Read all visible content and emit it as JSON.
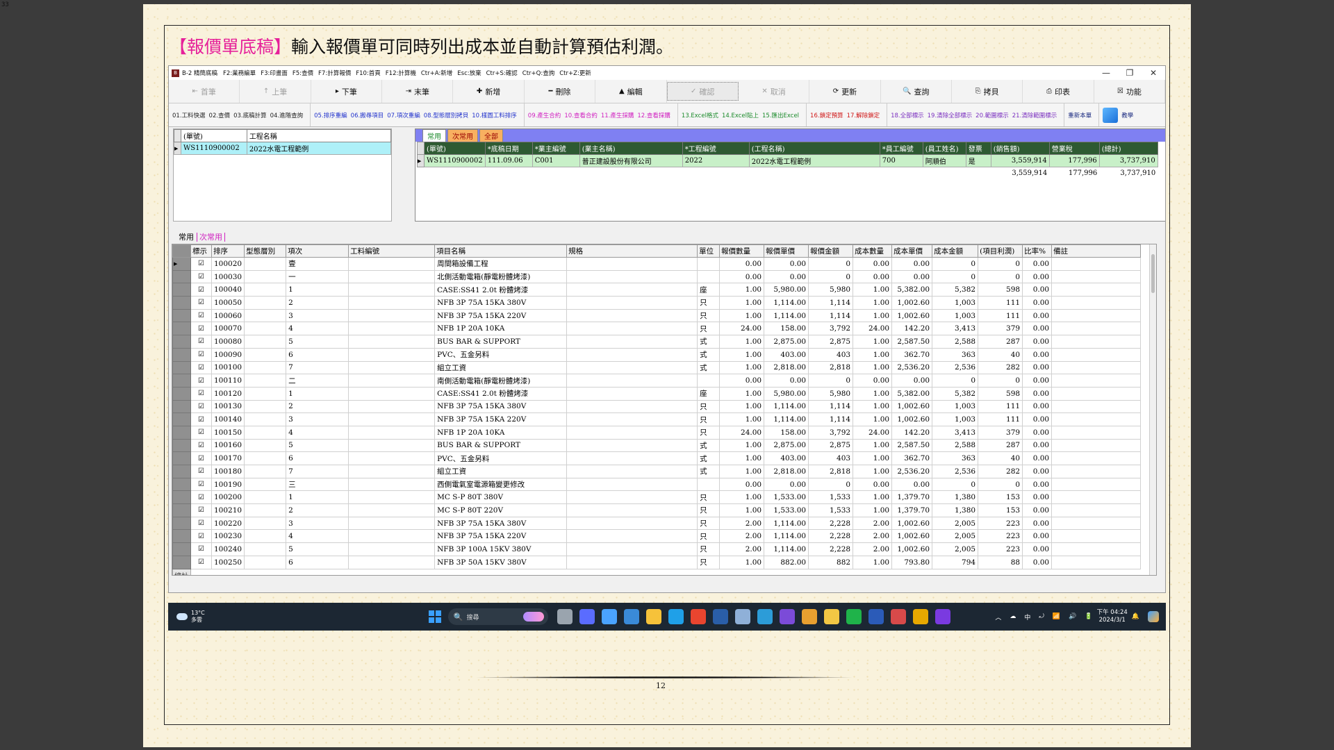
{
  "corner_text": "33",
  "heading": {
    "tag": "【報價單底稿】",
    "text": "輸入報價單可同時列出成本並自動計算預估利潤。"
  },
  "titlebar": {
    "app_icon": "B",
    "title": "B-2 精簡底稿",
    "shortcuts": [
      "F2:業務編單",
      "F3:印畫面",
      "F5:查價",
      "F7:計算報價",
      "F10:首頁",
      "F12:計算機",
      "Ctr+A:新增",
      "Esc:放棄",
      "Ctr+S:確認",
      "Ctr+Q:查詢",
      "Ctr+Z:更新"
    ],
    "controls": [
      "—",
      "❐",
      "✕"
    ]
  },
  "toolbar1": [
    {
      "label": "首筆",
      "icon": "⇤",
      "disabled": true
    },
    {
      "label": "上筆",
      "icon": "↑",
      "disabled": true
    },
    {
      "label": "下筆",
      "icon": "▸",
      "disabled": false
    },
    {
      "label": "末筆",
      "icon": "⇥",
      "disabled": false
    },
    {
      "label": "新增",
      "icon": "✚",
      "disabled": false
    },
    {
      "label": "刪除",
      "icon": "━",
      "disabled": false
    },
    {
      "label": "編輯",
      "icon": "▲",
      "disabled": false
    },
    {
      "label": "確認",
      "icon": "✓",
      "disabled": true,
      "focus": true
    },
    {
      "label": "取消",
      "icon": "✕",
      "disabled": true
    },
    {
      "label": "更新",
      "icon": "⟳",
      "disabled": false
    },
    {
      "label": "查詢",
      "icon": "🔍",
      "disabled": false
    },
    {
      "label": "拷貝",
      "icon": "⎘",
      "disabled": false
    },
    {
      "label": "印表",
      "icon": "⎙",
      "disabled": false
    },
    {
      "label": "功能",
      "icon": "☒",
      "disabled": false
    }
  ],
  "toolbar2": {
    "groups": [
      {
        "color": "c-black",
        "items": [
          "01.工料快選",
          "02.查價",
          "03.底稿計算",
          "04.進階查詢"
        ]
      },
      {
        "color": "c-blue",
        "items": [
          "05.排序重編",
          "06.搬尋項目",
          "07.項次重編",
          "08.型態層別拷貝",
          "10.樣圖工料排序"
        ]
      },
      {
        "color": "c-mag",
        "items": [
          "09.產生合約",
          "10.查看合約",
          "11.產生採購",
          "12.查看採購"
        ]
      },
      {
        "color": "c-green",
        "items": [
          "13.Excel格式",
          "14.Excel貼上",
          "15.匯出Excel"
        ]
      },
      {
        "color": "c-red",
        "items": [
          "16.鎖定預算",
          "17.解除鎖定"
        ]
      },
      {
        "color": "c-purple",
        "items": [
          "18.全部標示",
          "19.清除全部標示",
          "20.範圍標示",
          "21.清除範圍標示"
        ]
      },
      {
        "color": "c-navy",
        "items": [
          "重新本單"
        ]
      }
    ],
    "teach_label": "教學"
  },
  "mini_table": {
    "headers": [
      "(單號)",
      "工程名稱"
    ],
    "row": [
      "WS1110900002",
      "2022水電工程範例"
    ]
  },
  "right_panel": {
    "tabs": [
      "常用",
      "次常用",
      "全部"
    ],
    "headers": [
      "(單號)",
      "*底稿日期",
      "*業主編號",
      "(業主名稱)",
      "*工程編號",
      "(工程名稱)",
      "*員工編號",
      "(員工姓名)",
      "發票",
      "(銷售額)",
      "營業稅",
      "(總計)"
    ],
    "row": [
      "WS1110900002",
      "111.09.06",
      "C001",
      "普正建設股份有限公司",
      "2022",
      "2022水電工程範例",
      "700",
      "阿順伯",
      "是",
      "3,559,914",
      "177,996",
      "3,737,910"
    ],
    "totals": [
      "3,559,914",
      "177,996",
      "3,737,910"
    ]
  },
  "sub_tabs": [
    "常用",
    "次常用"
  ],
  "grid": {
    "headers": [
      "標示",
      "排序",
      "型態層別",
      "項次",
      "工料編號",
      "項目名稱",
      "規格",
      "單位",
      "報價數量",
      "報價單價",
      "報價金額",
      "成本數量",
      "成本單價",
      "成本金額",
      "(項目利潤)",
      "比率%",
      "備註"
    ],
    "checkbox_glyph": "☑",
    "rows": [
      [
        "100020",
        "",
        "壹",
        "",
        "周間箱設備工程",
        "",
        "",
        "0.00",
        "0.00",
        "0",
        "0.00",
        "0.00",
        "0",
        "0",
        "0.00",
        ""
      ],
      [
        "100030",
        "",
        "一",
        "",
        "北側活動電箱(靜電粉體烤漆)",
        "",
        "",
        "0.00",
        "0.00",
        "0",
        "0.00",
        "0.00",
        "0",
        "0",
        "0.00",
        ""
      ],
      [
        "100040",
        "",
        "1",
        "",
        "CASE:SS41 2.0t  粉體烤漆",
        "",
        "座",
        "1.00",
        "5,980.00",
        "5,980",
        "1.00",
        "5,382.00",
        "5,382",
        "598",
        "0.00",
        ""
      ],
      [
        "100050",
        "",
        "2",
        "",
        "NFB 3P 75A  15KA 380V",
        "",
        "只",
        "1.00",
        "1,114.00",
        "1,114",
        "1.00",
        "1,002.60",
        "1,003",
        "111",
        "0.00",
        ""
      ],
      [
        "100060",
        "",
        "3",
        "",
        "NFB 3P 75A  15KA 220V",
        "",
        "只",
        "1.00",
        "1,114.00",
        "1,114",
        "1.00",
        "1,002.60",
        "1,003",
        "111",
        "0.00",
        ""
      ],
      [
        "100070",
        "",
        "4",
        "",
        "NFB 1P 20A 10KA",
        "",
        "只",
        "24.00",
        "158.00",
        "3,792",
        "24.00",
        "142.20",
        "3,413",
        "379",
        "0.00",
        ""
      ],
      [
        "100080",
        "",
        "5",
        "",
        "BUS BAR & SUPPORT",
        "",
        "式",
        "1.00",
        "2,875.00",
        "2,875",
        "1.00",
        "2,587.50",
        "2,588",
        "287",
        "0.00",
        ""
      ],
      [
        "100090",
        "",
        "6",
        "",
        "PVC、五金另料",
        "",
        "式",
        "1.00",
        "403.00",
        "403",
        "1.00",
        "362.70",
        "363",
        "40",
        "0.00",
        ""
      ],
      [
        "100100",
        "",
        "7",
        "",
        "組立工資",
        "",
        "式",
        "1.00",
        "2,818.00",
        "2,818",
        "1.00",
        "2,536.20",
        "2,536",
        "282",
        "0.00",
        ""
      ],
      [
        "100110",
        "",
        "二",
        "",
        "南側活動電箱(靜電粉體烤漆)",
        "",
        "",
        "0.00",
        "0.00",
        "0",
        "0.00",
        "0.00",
        "0",
        "0",
        "0.00",
        ""
      ],
      [
        "100120",
        "",
        "1",
        "",
        "CASE:SS41 2.0t  粉體烤漆",
        "",
        "座",
        "1.00",
        "5,980.00",
        "5,980",
        "1.00",
        "5,382.00",
        "5,382",
        "598",
        "0.00",
        ""
      ],
      [
        "100130",
        "",
        "2",
        "",
        "NFB 3P 75A  15KA 380V",
        "",
        "只",
        "1.00",
        "1,114.00",
        "1,114",
        "1.00",
        "1,002.60",
        "1,003",
        "111",
        "0.00",
        ""
      ],
      [
        "100140",
        "",
        "3",
        "",
        "NFB 3P 75A  15KA 220V",
        "",
        "只",
        "1.00",
        "1,114.00",
        "1,114",
        "1.00",
        "1,002.60",
        "1,003",
        "111",
        "0.00",
        ""
      ],
      [
        "100150",
        "",
        "4",
        "",
        "NFB 1P 20A 10KA",
        "",
        "只",
        "24.00",
        "158.00",
        "3,792",
        "24.00",
        "142.20",
        "3,413",
        "379",
        "0.00",
        ""
      ],
      [
        "100160",
        "",
        "5",
        "",
        "BUS BAR & SUPPORT",
        "",
        "式",
        "1.00",
        "2,875.00",
        "2,875",
        "1.00",
        "2,587.50",
        "2,588",
        "287",
        "0.00",
        ""
      ],
      [
        "100170",
        "",
        "6",
        "",
        "PVC、五金另料",
        "",
        "式",
        "1.00",
        "403.00",
        "403",
        "1.00",
        "362.70",
        "363",
        "40",
        "0.00",
        ""
      ],
      [
        "100180",
        "",
        "7",
        "",
        "組立工資",
        "",
        "式",
        "1.00",
        "2,818.00",
        "2,818",
        "1.00",
        "2,536.20",
        "2,536",
        "282",
        "0.00",
        ""
      ],
      [
        "100190",
        "",
        "三",
        "",
        "西側電氣室電源箱變更修改",
        "",
        "",
        "0.00",
        "0.00",
        "0",
        "0.00",
        "0.00",
        "0",
        "0",
        "0.00",
        ""
      ],
      [
        "100200",
        "",
        "1",
        "",
        "MC S-P 80T 380V",
        "",
        "只",
        "1.00",
        "1,533.00",
        "1,533",
        "1.00",
        "1,379.70",
        "1,380",
        "153",
        "0.00",
        ""
      ],
      [
        "100210",
        "",
        "2",
        "",
        "MC S-P 80T 220V",
        "",
        "只",
        "1.00",
        "1,533.00",
        "1,533",
        "1.00",
        "1,379.70",
        "1,380",
        "153",
        "0.00",
        ""
      ],
      [
        "100220",
        "",
        "3",
        "",
        "NFB 3P 75A  15KA 380V",
        "",
        "只",
        "2.00",
        "1,114.00",
        "2,228",
        "2.00",
        "1,002.60",
        "2,005",
        "223",
        "0.00",
        ""
      ],
      [
        "100230",
        "",
        "4",
        "",
        "NFB 3P 75A  15KA 220V",
        "",
        "只",
        "2.00",
        "1,114.00",
        "2,228",
        "2.00",
        "1,002.60",
        "2,005",
        "223",
        "0.00",
        ""
      ],
      [
        "100240",
        "",
        "5",
        "",
        "NFB 3P 100A 15KV 380V",
        "",
        "只",
        "2.00",
        "1,114.00",
        "2,228",
        "2.00",
        "1,002.60",
        "2,005",
        "223",
        "0.00",
        ""
      ],
      [
        "100250",
        "",
        "6",
        "",
        "NFB 3P 50A 15KV 380V",
        "",
        "只",
        "1.00",
        "882.00",
        "882",
        "1.00",
        "793.80",
        "794",
        "88",
        "0.00",
        ""
      ]
    ],
    "total_label": "總計"
  },
  "taskbar": {
    "temperature": "13°C",
    "weather": "多雲",
    "search_placeholder": "搜尋",
    "icon_colors": [
      "#9aa4ae",
      "#5a6cff",
      "#4aa3ff",
      "#3a8ad8",
      "#f6c23a",
      "#1fa0e8",
      "#e9452f",
      "#2a5ea8",
      "#8fb0d8",
      "#2c9cd8",
      "#7b4bd8",
      "#e8a030",
      "#f2c744",
      "#1fb34a",
      "#2b5bb8",
      "#d84a4a",
      "#e7a800",
      "#7a3ae0"
    ],
    "tray": [
      "︿",
      "☁",
      "中",
      "⤾",
      "📶",
      "🔊",
      "🔋"
    ],
    "time": "下午 04:24",
    "date": "2024/3/1"
  },
  "page_number": "12"
}
